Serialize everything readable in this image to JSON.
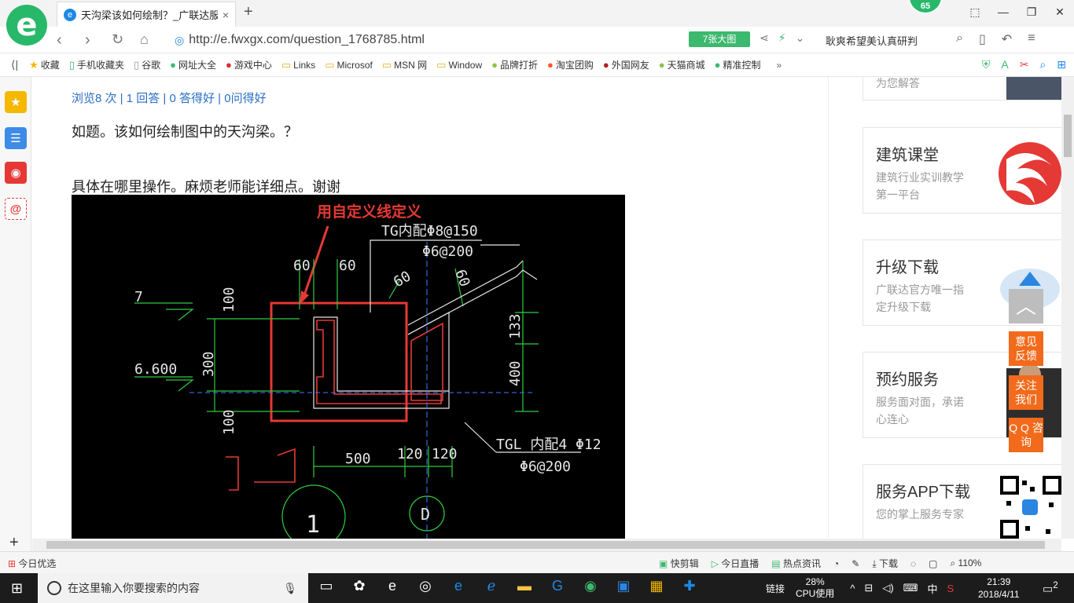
{
  "browser": {
    "tab_title": "天沟梁该如何绘制？_广联达服务",
    "tab_close": "×",
    "new_tab": "+",
    "badge": "65",
    "url": "http://e.fwxgx.com/question_1768785.html",
    "big_image_label": "7张大图",
    "search_text": "耿爽希望美认真研判",
    "window_controls": [
      "⬚",
      "—",
      "❐",
      "✕"
    ]
  },
  "bookmarks": [
    {
      "icon": "★",
      "label": "收藏"
    },
    {
      "icon": "▯",
      "label": "手机收藏夹"
    },
    {
      "icon": "▯",
      "label": "谷歌"
    },
    {
      "icon": "●",
      "label": "网址大全"
    },
    {
      "icon": "●",
      "label": "游戏中心"
    },
    {
      "icon": "▭",
      "label": "Links"
    },
    {
      "icon": "▭",
      "label": "Microsof"
    },
    {
      "icon": "▭",
      "label": "MSN 网"
    },
    {
      "icon": "▭",
      "label": "Window"
    },
    {
      "icon": "●",
      "label": "品牌打折"
    },
    {
      "icon": "●",
      "label": "淘宝团购"
    },
    {
      "icon": "●",
      "label": "外国网友"
    },
    {
      "icon": "●",
      "label": "天猫商城"
    },
    {
      "icon": "●",
      "label": "精准控制"
    }
  ],
  "bookmarks_more": "»",
  "question": {
    "stats": "浏览8 次 | 1 回答 | 0 答得好 | 0问得好",
    "line1": "如题。该如何绘制图中的天沟梁。？",
    "line2": "具体在哪里操作。麻烦老师能详细点。谢谢"
  },
  "drawing": {
    "annotation": "用自定义线定义",
    "labels": {
      "tg1": "TG内配Φ8@150",
      "tg2": "Φ6@200",
      "tgl1": "TGL 内配4 Φ12",
      "tgl2": "Φ6@200",
      "d60a": "60",
      "d60b": "60",
      "d60c": "60",
      "d60d": "60",
      "d100a": "100",
      "d300": "300",
      "d100b": "100",
      "d133": "133",
      "d400": "400",
      "d500": "500",
      "d120a": "120",
      "d120b": "120",
      "lvl7": "7",
      "lvl6600": "6.600",
      "axis1": "1",
      "axisD": "D"
    }
  },
  "right_cards": [
    {
      "title": "",
      "desc": "为您解答"
    },
    {
      "title": "建筑课堂",
      "desc": "建筑行业实训教学第一平台"
    },
    {
      "title": "升级下载",
      "desc": "广联达官方唯一指定升级下载"
    },
    {
      "title": "预约服务",
      "desc": "服务面对面，承诺心连心"
    },
    {
      "title": "服务APP下载",
      "desc": "您的掌上服务专家"
    }
  ],
  "float_buttons": {
    "top": "︿",
    "feedback": "意见 反馈",
    "follow": "关注 我们",
    "qq": "Q Q 咨询"
  },
  "statusbar": {
    "left": "今日优选",
    "items": [
      "快剪辑",
      "今日直播",
      "热点资讯",
      "下载",
      "110%"
    ]
  },
  "taskbar": {
    "search_placeholder": "在这里输入你要搜索的内容",
    "link": "链接",
    "cpu_percent": "28%",
    "cpu_label": "CPU使用",
    "ime": "中",
    "time": "21:39",
    "date": "2018/4/11",
    "notifications": "2"
  }
}
